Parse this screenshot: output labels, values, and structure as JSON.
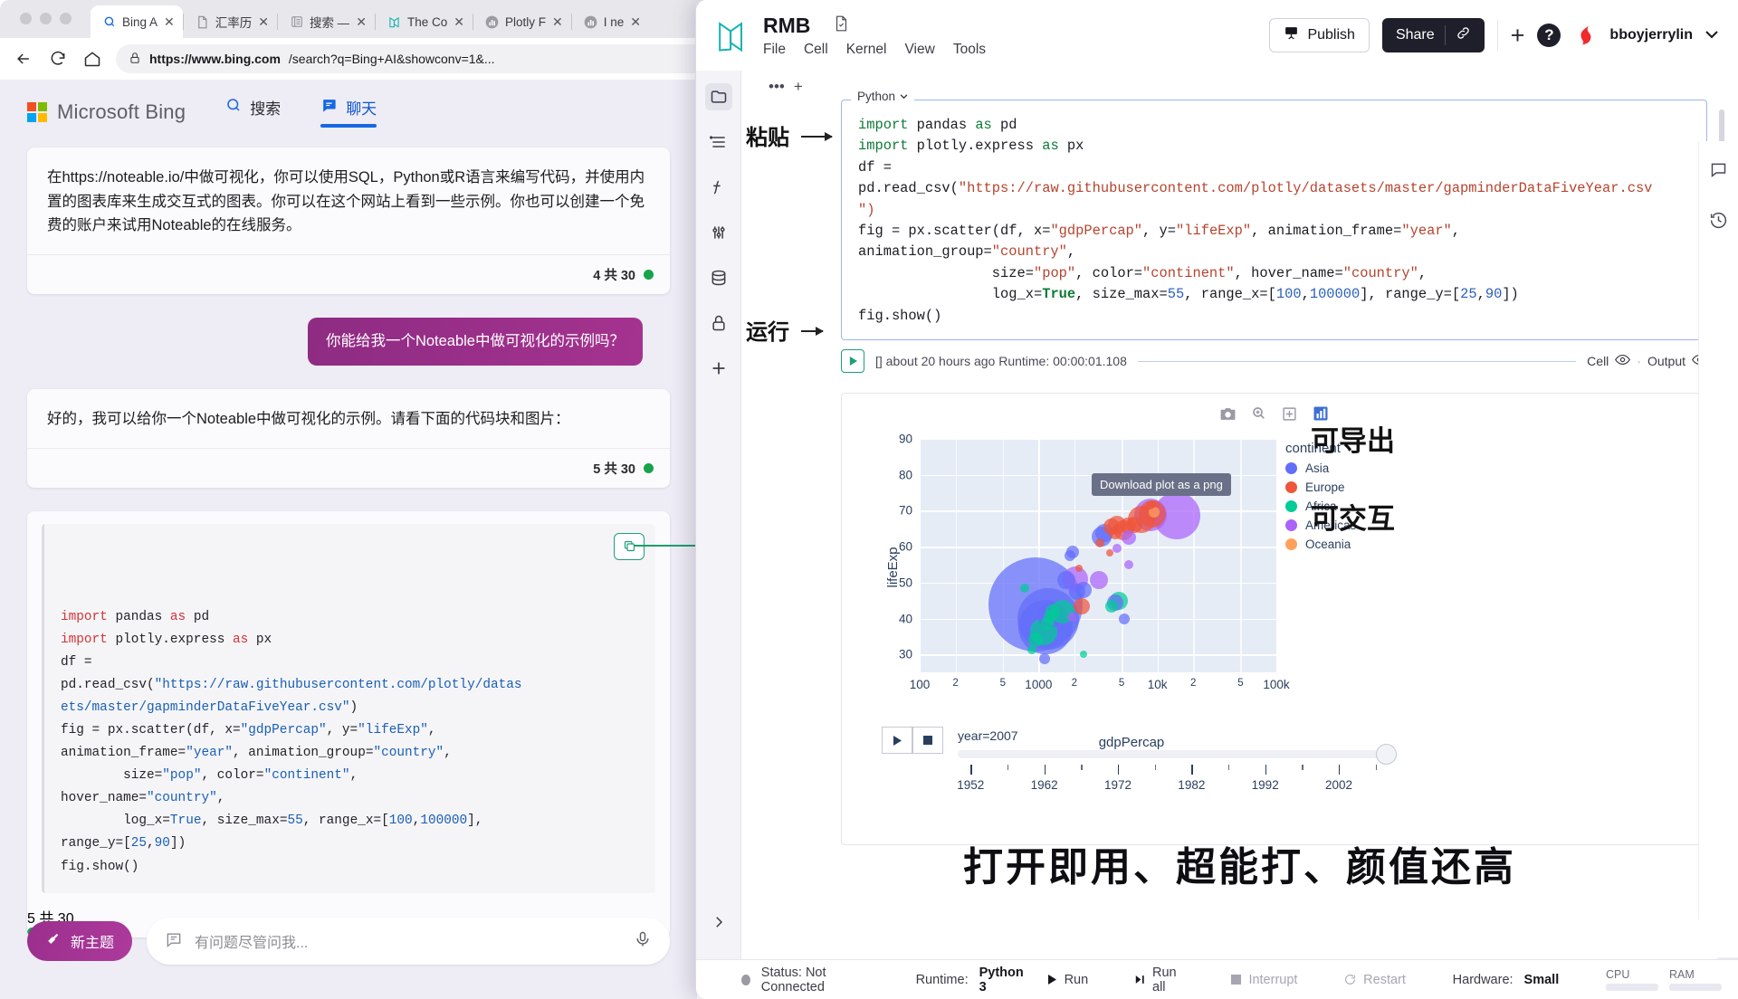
{
  "browser": {
    "tabs": [
      {
        "title": "Bing A",
        "icon": "search-icon",
        "active": true
      },
      {
        "title": "汇率历",
        "icon": "document-icon",
        "active": false
      },
      {
        "title": "搜索 —",
        "icon": "list-icon",
        "active": false
      },
      {
        "title": "The Co",
        "icon": "noteable-icon",
        "active": false
      },
      {
        "title": "Plotly F",
        "icon": "chart-icon",
        "active": false
      },
      {
        "title": "I ne",
        "icon": "chart-icon",
        "active": false
      }
    ],
    "url_host": "https://www.bing.com",
    "url_rest": "/search?q=Bing+AI&showconv=1&...",
    "close_label": "✕"
  },
  "bing": {
    "brand": "Microsoft Bing",
    "tabs": [
      {
        "label": "搜索",
        "icon": "search-icon",
        "selected": false
      },
      {
        "label": "聊天",
        "icon": "chat-icon",
        "selected": true
      }
    ],
    "messages": [
      {
        "type": "bot",
        "text": "在https://noteable.io/中做可视化，你可以使用SQL，Python或R语言来编写代码，并使用内置的图表库来生成交互式的图表。你可以在这个网站上看到一些示例。你也可以创建一个免费的账户来试用Noteable的在线服务。",
        "counter": "4 共 30"
      },
      {
        "type": "user",
        "text": "你能给我一个Noteable中做可视化的示例吗？"
      },
      {
        "type": "bot",
        "text": "好的，我可以给你一个Noteable中做可视化的示例。请看下面的代码块和图片：",
        "counter": "5 共 30"
      }
    ],
    "code_counter": "5 共 30",
    "code_lines": [
      [
        {
          "t": "import ",
          "c": "kw"
        },
        {
          "t": "pandas ",
          "c": ""
        },
        {
          "t": "as ",
          "c": "kw"
        },
        {
          "t": "pd",
          "c": ""
        }
      ],
      [
        {
          "t": "import ",
          "c": "kw"
        },
        {
          "t": "plotly.express ",
          "c": ""
        },
        {
          "t": "as ",
          "c": "kw"
        },
        {
          "t": "px",
          "c": ""
        }
      ],
      [
        {
          "t": "df =",
          "c": ""
        }
      ],
      [
        {
          "t": "pd.read_csv(",
          "c": ""
        },
        {
          "t": "\"https://raw.githubusercontent.com/plotly/datas",
          "c": "str"
        }
      ],
      [
        {
          "t": "ets/master/gapminderDataFiveYear.csv\"",
          "c": "str"
        },
        {
          "t": ")",
          "c": ""
        }
      ],
      [
        {
          "t": "fig = px.scatter(df, x=",
          "c": ""
        },
        {
          "t": "\"gdpPercap\"",
          "c": "str"
        },
        {
          "t": ", y=",
          "c": ""
        },
        {
          "t": "\"lifeExp\"",
          "c": "str"
        },
        {
          "t": ",",
          "c": ""
        }
      ],
      [
        {
          "t": "animation_frame=",
          "c": ""
        },
        {
          "t": "\"year\"",
          "c": "str"
        },
        {
          "t": ", animation_group=",
          "c": ""
        },
        {
          "t": "\"country\"",
          "c": "str"
        },
        {
          "t": ",",
          "c": ""
        }
      ],
      [
        {
          "t": "        size=",
          "c": ""
        },
        {
          "t": "\"pop\"",
          "c": "str"
        },
        {
          "t": ", color=",
          "c": ""
        },
        {
          "t": "\"continent\"",
          "c": "str"
        },
        {
          "t": ",",
          "c": ""
        }
      ],
      [
        {
          "t": "hover_name=",
          "c": ""
        },
        {
          "t": "\"country\"",
          "c": "str"
        },
        {
          "t": ",",
          "c": ""
        }
      ],
      [
        {
          "t": "        log_x=",
          "c": ""
        },
        {
          "t": "True",
          "c": "num"
        },
        {
          "t": ", size_max=",
          "c": ""
        },
        {
          "t": "55",
          "c": "num"
        },
        {
          "t": ", range_x=[",
          "c": ""
        },
        {
          "t": "100",
          "c": "num"
        },
        {
          "t": ",",
          "c": ""
        },
        {
          "t": "100000",
          "c": "num"
        },
        {
          "t": "],",
          "c": ""
        }
      ],
      [
        {
          "t": "range_y=[",
          "c": ""
        },
        {
          "t": "25",
          "c": "num"
        },
        {
          "t": ",",
          "c": ""
        },
        {
          "t": "90",
          "c": "num"
        },
        {
          "t": "])",
          "c": ""
        }
      ],
      [
        {
          "t": "fig.show()",
          "c": ""
        }
      ]
    ],
    "new_topic": "新主题",
    "ask_placeholder": "有问题尽管问我..."
  },
  "noteable": {
    "title": "RMB",
    "menu": [
      "File",
      "Cell",
      "Kernel",
      "View",
      "Tools"
    ],
    "publish": "Publish",
    "share": "Share",
    "username": "bboyjerrylin",
    "cell_language": "Python",
    "cell_code_lines": [
      [
        {
          "t": "import ",
          "c": "kw"
        },
        {
          "t": "pandas ",
          "c": ""
        },
        {
          "t": "as ",
          "c": "kw"
        },
        {
          "t": "pd",
          "c": ""
        }
      ],
      [
        {
          "t": "import ",
          "c": "kw"
        },
        {
          "t": "plotly.express ",
          "c": ""
        },
        {
          "t": "as ",
          "c": "kw"
        },
        {
          "t": "px",
          "c": ""
        }
      ],
      [
        {
          "t": "df =",
          "c": ""
        }
      ],
      [
        {
          "t": "pd.read_csv(",
          "c": ""
        },
        {
          "t": "\"https://raw.githubusercontent.com/plotly/datasets/master/gapminderDataFiveYear.csv",
          "c": "str"
        }
      ],
      [
        {
          "t": "\")",
          "c": "str"
        }
      ],
      [
        {
          "t": "fig = px.scatter(df, x=",
          "c": ""
        },
        {
          "t": "\"gdpPercap\"",
          "c": "str"
        },
        {
          "t": ", y=",
          "c": ""
        },
        {
          "t": "\"lifeExp\"",
          "c": "str"
        },
        {
          "t": ", animation_frame=",
          "c": ""
        },
        {
          "t": "\"year\"",
          "c": "str"
        },
        {
          "t": ",",
          "c": ""
        }
      ],
      [
        {
          "t": "animation_group=",
          "c": ""
        },
        {
          "t": "\"country\"",
          "c": "str"
        },
        {
          "t": ",",
          "c": ""
        }
      ],
      [
        {
          "t": "                size=",
          "c": ""
        },
        {
          "t": "\"pop\"",
          "c": "str"
        },
        {
          "t": ", color=",
          "c": ""
        },
        {
          "t": "\"continent\"",
          "c": "str"
        },
        {
          "t": ", hover_name=",
          "c": ""
        },
        {
          "t": "\"country\"",
          "c": "str"
        },
        {
          "t": ",",
          "c": ""
        }
      ],
      [
        {
          "t": "                log_x=",
          "c": ""
        },
        {
          "t": "True",
          "c": "bool"
        },
        {
          "t": ", size_max=",
          "c": ""
        },
        {
          "t": "55",
          "c": "num"
        },
        {
          "t": ", range_x=[",
          "c": ""
        },
        {
          "t": "100",
          "c": "num"
        },
        {
          "t": ",",
          "c": ""
        },
        {
          "t": "100000",
          "c": "num"
        },
        {
          "t": "], range_y=[",
          "c": ""
        },
        {
          "t": "25",
          "c": "num"
        },
        {
          "t": ",",
          "c": ""
        },
        {
          "t": "90",
          "c": "num"
        },
        {
          "t": "])",
          "c": ""
        }
      ],
      [
        {
          "t": "fig.show()",
          "c": ""
        }
      ]
    ],
    "run_meta": "[] about 20 hours ago Runtime: 00:00:01.108",
    "cell_toggle": "Cell",
    "output_toggle": "Output",
    "tooltip": "Download plot as a png",
    "status": {
      "connection": "Status: Not Connected",
      "runtime_label": "Runtime:",
      "runtime_value": "Python 3",
      "run": "Run",
      "run_all": "Run all",
      "interrupt": "Interrupt",
      "restart": "Restart",
      "hardware_label": "Hardware:",
      "hardware_value": "Small",
      "cpu": "CPU",
      "ram": "RAM"
    }
  },
  "annotations": {
    "paste": "粘贴",
    "run": "运行",
    "exportable": "可导出",
    "interactive": "可交互",
    "tagline": "打开即用、超能打、颜值还高"
  },
  "chart_data": {
    "type": "scatter",
    "title": "",
    "xlabel": "gdpPercap",
    "ylabel": "lifeExp",
    "xscale": "log",
    "xlim": [
      100,
      100000
    ],
    "ylim": [
      25,
      90
    ],
    "ytick_labels": [
      "30",
      "40",
      "50",
      "60",
      "70",
      "80",
      "90"
    ],
    "xtick_major": [
      "100",
      "1000",
      "10k",
      "100k"
    ],
    "xtick_minor": [
      "2",
      "5",
      "2",
      "5",
      "2",
      "5"
    ],
    "legend_title": "continent",
    "legend": [
      {
        "name": "Asia",
        "color": "#636efa"
      },
      {
        "name": "Europe",
        "color": "#ef553b"
      },
      {
        "name": "Africa",
        "color": "#00cc96"
      },
      {
        "name": "Americas",
        "color": "#ab63fa"
      },
      {
        "name": "Oceania",
        "color": "#ffa15a"
      }
    ],
    "animation_frame_label": "year=2007",
    "slider_ticks": [
      "1952",
      "1962",
      "1972",
      "1982",
      "1992",
      "2002"
    ],
    "points": [
      {
        "x": 944,
        "y": 43.8,
        "r": 52,
        "c": "#636efa"
      },
      {
        "x": 1200,
        "y": 40.0,
        "r": 34,
        "c": "#636efa"
      },
      {
        "x": 1150,
        "y": 37.5,
        "r": 30,
        "c": "#636efa"
      },
      {
        "x": 1250,
        "y": 41.0,
        "r": 14,
        "c": "#636efa"
      },
      {
        "x": 1700,
        "y": 50.8,
        "r": 10,
        "c": "#636efa"
      },
      {
        "x": 2100,
        "y": 47.5,
        "r": 9,
        "c": "#636efa"
      },
      {
        "x": 2400,
        "y": 48.0,
        "r": 9,
        "c": "#636efa"
      },
      {
        "x": 1950,
        "y": 58.5,
        "r": 7,
        "c": "#636efa"
      },
      {
        "x": 1850,
        "y": 57.5,
        "r": 6,
        "c": "#636efa"
      },
      {
        "x": 3400,
        "y": 62.8,
        "r": 11,
        "c": "#636efa"
      },
      {
        "x": 3600,
        "y": 63.8,
        "r": 10,
        "c": "#636efa"
      },
      {
        "x": 4400,
        "y": 44.5,
        "r": 9,
        "c": "#636efa"
      },
      {
        "x": 1130,
        "y": 28.8,
        "r": 6,
        "c": "#636efa"
      },
      {
        "x": 5300,
        "y": 40.0,
        "r": 6,
        "c": "#636efa"
      },
      {
        "x": 4100,
        "y": 65.5,
        "r": 9,
        "c": "#ef553b"
      },
      {
        "x": 4600,
        "y": 66.0,
        "r": 10,
        "c": "#ef553b"
      },
      {
        "x": 5200,
        "y": 64.5,
        "r": 11,
        "c": "#ef553b"
      },
      {
        "x": 5600,
        "y": 65.8,
        "r": 9,
        "c": "#ef553b"
      },
      {
        "x": 6400,
        "y": 66.0,
        "r": 9,
        "c": "#ef553b"
      },
      {
        "x": 7400,
        "y": 67.5,
        "r": 15,
        "c": "#ef553b"
      },
      {
        "x": 9000,
        "y": 69.2,
        "r": 15,
        "c": "#ef553b"
      },
      {
        "x": 8800,
        "y": 71.5,
        "r": 5,
        "c": "#ef553b"
      },
      {
        "x": 9400,
        "y": 71.8,
        "r": 4,
        "c": "#ef553b"
      },
      {
        "x": 3300,
        "y": 61.0,
        "r": 5,
        "c": "#ef553b"
      },
      {
        "x": 4000,
        "y": 58.2,
        "r": 4,
        "c": "#ef553b"
      },
      {
        "x": 2200,
        "y": 54.0,
        "r": 4,
        "c": "#ef553b"
      },
      {
        "x": 2300,
        "y": 43.5,
        "r": 9,
        "c": "#ef553b"
      },
      {
        "x": 4400,
        "y": 63.8,
        "r": 7,
        "c": "#ef553b"
      },
      {
        "x": 1100,
        "y": 36.3,
        "r": 15,
        "c": "#00cc96"
      },
      {
        "x": 1600,
        "y": 42.0,
        "r": 13,
        "c": "#00cc96"
      },
      {
        "x": 1320,
        "y": 42.0,
        "r": 8,
        "c": "#00cc96"
      },
      {
        "x": 1250,
        "y": 40.5,
        "r": 7,
        "c": "#00cc96"
      },
      {
        "x": 1180,
        "y": 38.5,
        "r": 7,
        "c": "#00cc96"
      },
      {
        "x": 950,
        "y": 34.2,
        "r": 8,
        "c": "#00cc96"
      },
      {
        "x": 880,
        "y": 31.2,
        "r": 5,
        "c": "#00cc96"
      },
      {
        "x": 760,
        "y": 48.5,
        "r": 5,
        "c": "#00cc96"
      },
      {
        "x": 4700,
        "y": 44.8,
        "r": 10,
        "c": "#00cc96"
      },
      {
        "x": 4100,
        "y": 43.5,
        "r": 7,
        "c": "#00cc96"
      },
      {
        "x": 2400,
        "y": 30.0,
        "r": 4,
        "c": "#00cc96"
      },
      {
        "x": 2050,
        "y": 50.9,
        "r": 14,
        "c": "#ab63fa"
      },
      {
        "x": 3200,
        "y": 50.8,
        "r": 10,
        "c": "#ab63fa"
      },
      {
        "x": 14500,
        "y": 68.5,
        "r": 26,
        "c": "#ab63fa"
      },
      {
        "x": 8800,
        "y": 68.8,
        "r": 18,
        "c": "#ab63fa"
      },
      {
        "x": 5700,
        "y": 62.5,
        "r": 8,
        "c": "#ab63fa"
      },
      {
        "x": 4600,
        "y": 59.5,
        "r": 5,
        "c": "#ab63fa"
      },
      {
        "x": 5700,
        "y": 55.0,
        "r": 5,
        "c": "#ab63fa"
      },
      {
        "x": 1900,
        "y": 40.5,
        "r": 5,
        "c": "#ab63fa"
      },
      {
        "x": 9300,
        "y": 69.5,
        "r": 6,
        "c": "#ffa15a"
      }
    ]
  }
}
